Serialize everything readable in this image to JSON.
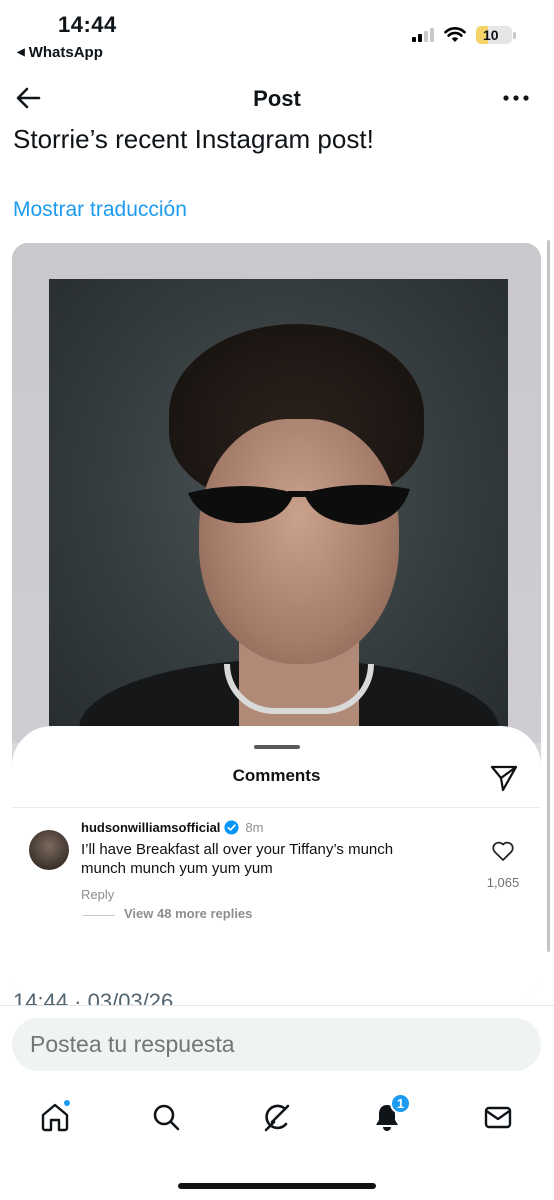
{
  "status_bar": {
    "time": "14:44",
    "back_app": "WhatsApp",
    "battery": "10"
  },
  "header": {
    "title": "Post",
    "back_icon": "arrow-left-icon",
    "more_icon": "more-horizontal-icon"
  },
  "post": {
    "text": "Storrie’s recent Instagram post!",
    "translate_label": "Mostrar traducción",
    "timestamp": "14:44 · 03/03/26"
  },
  "comments_sheet": {
    "title": "Comments",
    "comment": {
      "username": "hudsonwilliamsofficial",
      "time": "8m",
      "text": "I’ll have Breakfast all over your Tiffany’s munch munch munch yum yum yum",
      "reply_label": "Reply",
      "view_replies": "View 48 more replies",
      "like_count": "1,065"
    }
  },
  "reply_bar": {
    "placeholder": "Postea tu respuesta"
  },
  "bottom_nav": {
    "items": [
      "home-icon",
      "search-icon",
      "grok-icon",
      "notifications-icon",
      "messages-icon"
    ],
    "notifications_badge": "1"
  },
  "colors": {
    "accent": "#1d9bf0",
    "text": "#0f1419",
    "muted": "#536471"
  }
}
